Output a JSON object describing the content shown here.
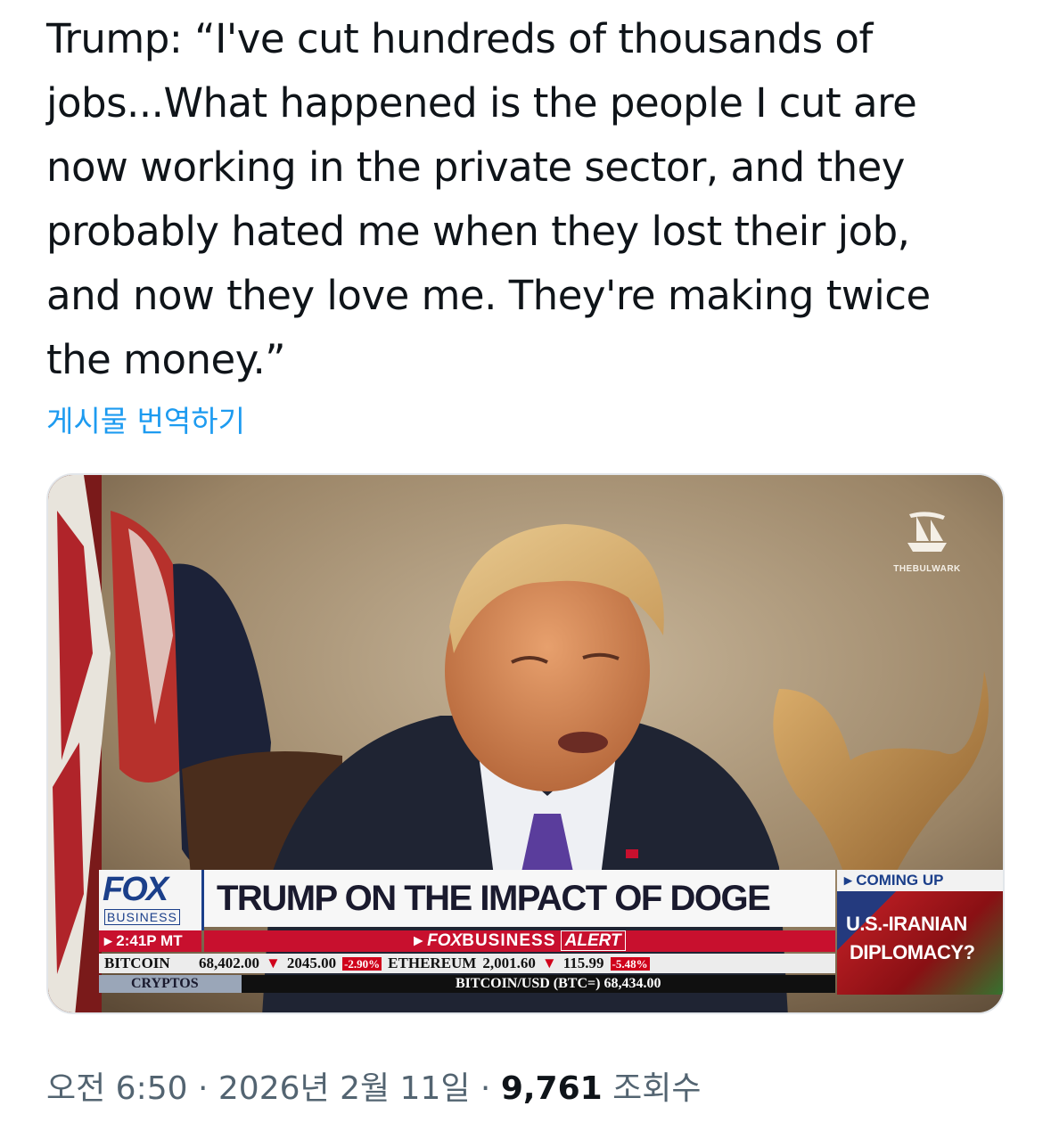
{
  "tweet": {
    "lines": [
      "Trump: “I've cut hundreds of thousands of",
      "jobs...What happened is the people I cut are",
      "now working in the private sector, and they",
      "probably hated me when they lost their job,",
      "and now they love me. They're making twice",
      "the money.”"
    ],
    "translate_label": "게시물 번역하기"
  },
  "media": {
    "watermark": "THEBULWARK",
    "chyron": {
      "network_top": "FOX",
      "network_bottom": "BUSINESS",
      "headline": "TRUMP ON THE IMPACT OF DOGE",
      "time": "▸ 2:41P MT",
      "alert_prefix": "▸",
      "alert_fox": "FOX",
      "alert_business": "BUSINESS",
      "alert_word": "ALERT",
      "coming_up_label": "▸ COMING UP",
      "coming_up_line1": "U.S.-IRANIAN",
      "coming_up_line2": "DIPLOMACY?",
      "ticker_label": "BITCOIN",
      "ticker_row1": [
        {
          "text": "68,402.00",
          "color": "#111111"
        },
        {
          "text": "▼",
          "color": "#d0021b"
        },
        {
          "text": "2045.00",
          "color": "#111111"
        },
        {
          "text": "-2.90%",
          "color": "#ffffff",
          "bg": "#d0021b"
        },
        {
          "text": "ETHEREUM",
          "color": "#111111"
        },
        {
          "text": "2,001.60",
          "color": "#111111"
        },
        {
          "text": "▼",
          "color": "#d0021b"
        },
        {
          "text": "115.99",
          "color": "#111111"
        },
        {
          "text": "-5.48%",
          "color": "#ffffff",
          "bg": "#d0021b"
        }
      ],
      "cryptos_label": "CRYPTOS",
      "ticker_row2": "BITCOIN/USD (BTC=) 68,434.00"
    }
  },
  "meta": {
    "time": "오전 6:50",
    "sep1": "·",
    "date": "2026년 2월 11일",
    "sep2": "·",
    "views": "9,761",
    "views_label": "조회수"
  },
  "colors": {
    "text": "#0f1419",
    "link": "#1d9bf0",
    "muted": "#536471",
    "fox_blue": "#1b3f8a",
    "alert_red": "#c8102e"
  }
}
